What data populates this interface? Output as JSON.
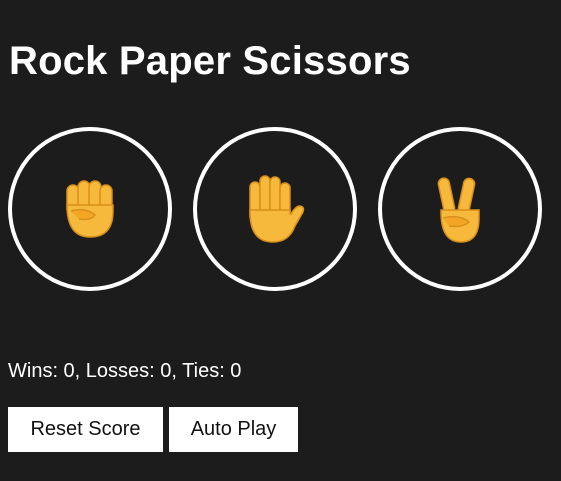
{
  "game": {
    "title": "Rock Paper Scissors"
  },
  "moves": [
    {
      "name": "rock",
      "icon": "raised-fist-icon"
    },
    {
      "name": "paper",
      "icon": "raised-hand-icon"
    },
    {
      "name": "scissors",
      "icon": "victory-hand-icon"
    }
  ],
  "score": {
    "text": "Wins: 0, Losses: 0, Ties: 0",
    "wins": 0,
    "losses": 0,
    "ties": 0
  },
  "controls": {
    "reset_label": "Reset Score",
    "autoplay_label": "Auto Play"
  },
  "colors": {
    "background": "#1c1c1c",
    "text": "#ffffff",
    "emoji": "#f6b93b"
  }
}
